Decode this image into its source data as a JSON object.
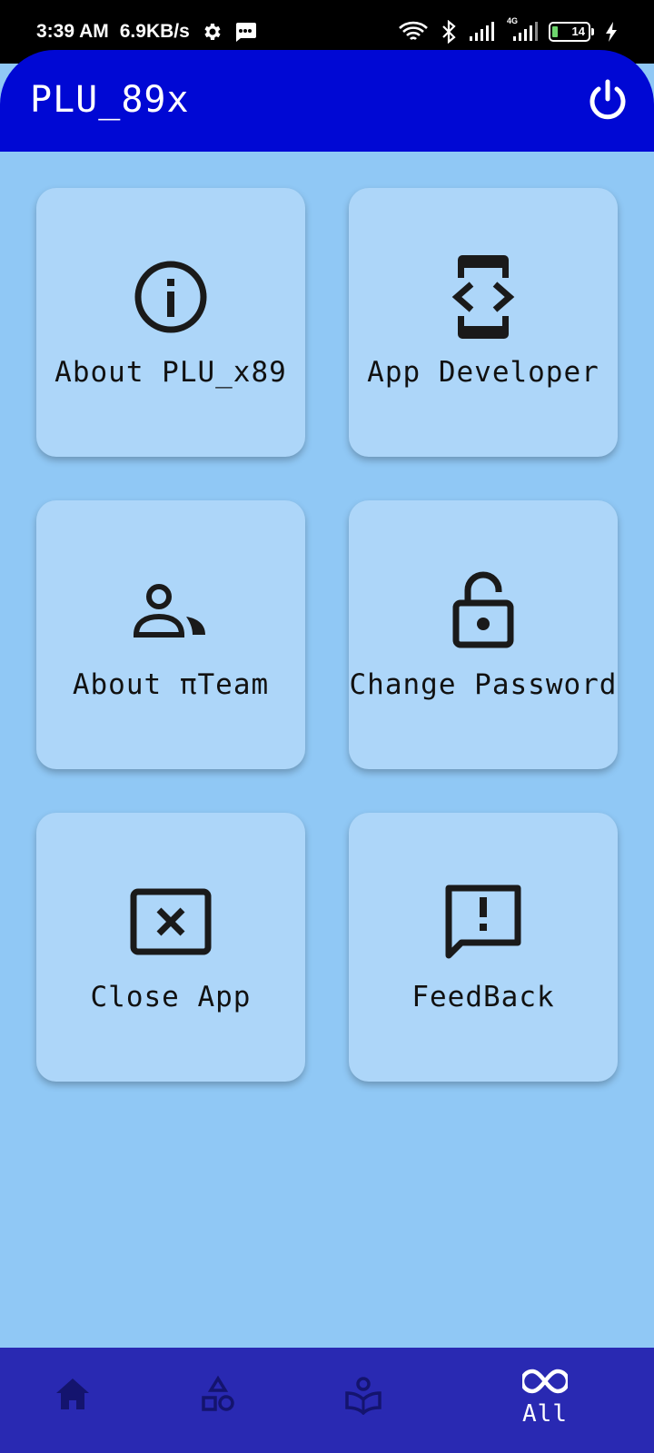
{
  "status_bar": {
    "time": "3:39 AM",
    "speed": "6.9KB/s",
    "battery_level": "14",
    "network": "4G"
  },
  "app_bar": {
    "title": "PLU_89x",
    "power_icon": "power-icon"
  },
  "menu": {
    "items": [
      {
        "label": "About PLU_x89",
        "icon": "info-icon"
      },
      {
        "label": "App Developer",
        "icon": "developer-mode-icon"
      },
      {
        "label": "About πTeam",
        "icon": "group-icon"
      },
      {
        "label": "Change Password",
        "icon": "lock-open-icon"
      },
      {
        "label": "Close App",
        "icon": "close-box-icon"
      },
      {
        "label": "FeedBack",
        "icon": "feedback-icon"
      }
    ]
  },
  "bottom_nav": {
    "items": [
      {
        "icon": "home-icon",
        "label": ""
      },
      {
        "icon": "category-icon",
        "label": ""
      },
      {
        "icon": "reader-icon",
        "label": ""
      },
      {
        "icon": "infinity-icon",
        "label": "All"
      }
    ],
    "active_color": "#ffffff",
    "inactive_color": "#14146e"
  },
  "colors": {
    "app_bar": "#0008d4",
    "background": "#90c8f5",
    "card": "#add6f9",
    "nav": "#2929b2"
  }
}
